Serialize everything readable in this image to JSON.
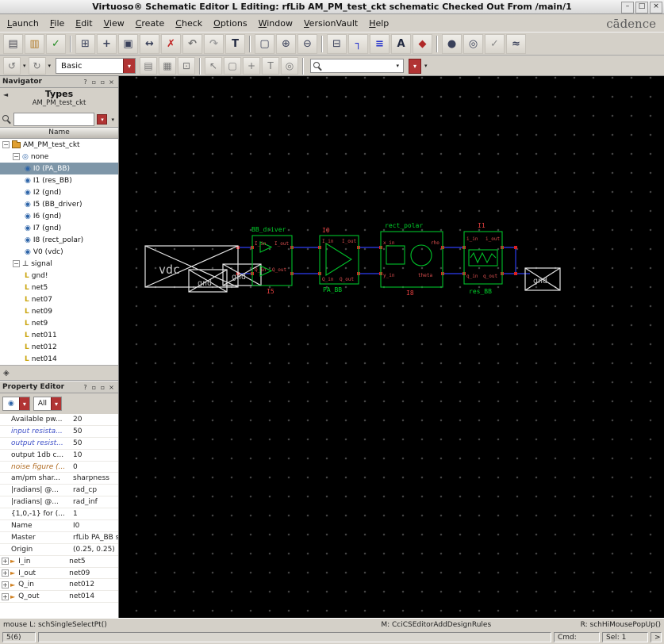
{
  "window": {
    "title": "Virtuoso® Schematic Editor L Editing: rfLib AM_PM_test_ckt schematic Checked Out From /main/1",
    "minimize": "–",
    "maximize": "□",
    "close": "×"
  },
  "menu": {
    "items": [
      "Launch",
      "File",
      "Edit",
      "View",
      "Create",
      "Check",
      "Options",
      "Window",
      "VersionVault",
      "Help"
    ],
    "brand": "cādence"
  },
  "icons": {
    "caret_down": "▾",
    "collapse": "−",
    "expand": "+",
    "help": "?",
    "float": "▫",
    "dock": "▫",
    "close": "×",
    "back": "◄",
    "port": "►",
    "instance": "◉",
    "none_group": "◎",
    "signal_group": "⊥",
    "signal": "L",
    "footer": "◈"
  },
  "toolbar_main": {
    "icons": [
      {
        "name": "new-cellview-icon",
        "glyph": "▤",
        "style": "color:#4a4a55"
      },
      {
        "name": "open-icon",
        "glyph": "▥",
        "style": "color:#b07a28"
      },
      {
        "name": "save-icon",
        "glyph": "✓",
        "style": "color:#1f8a1f;font-weight:bold"
      },
      {
        "name": "descend-icon",
        "glyph": "⊞",
        "style": "color:#39405a"
      },
      {
        "name": "move-icon",
        "glyph": "+",
        "style": "color:#39405a;font-weight:bold"
      },
      {
        "name": "copy-icon",
        "glyph": "▣",
        "style": "color:#39405a"
      },
      {
        "name": "stretch-icon",
        "glyph": "↔",
        "style": "color:#39405a;font-weight:bold"
      },
      {
        "name": "delete-icon",
        "glyph": "✗",
        "style": "color:#c02020;font-weight:bold"
      },
      {
        "name": "undo-icon",
        "glyph": "↶",
        "style": "color:#707070;font-weight:bold"
      },
      {
        "name": "redo-icon",
        "glyph": "↷",
        "style": "color:#9a9a9a;font-weight:bold"
      },
      {
        "name": "property-icon",
        "glyph": "T",
        "style": "color:#202840;font-weight:bold"
      },
      {
        "name": "zoom-fit-icon",
        "glyph": "▢",
        "style": "color:#39405a"
      },
      {
        "name": "zoom-in-icon",
        "glyph": "⊕",
        "style": "color:#39405a"
      },
      {
        "name": "zoom-out-icon",
        "glyph": "⊖",
        "style": "color:#39405a"
      },
      {
        "name": "instance-icon",
        "glyph": "⊟",
        "style": "color:#39405a"
      },
      {
        "name": "wire-icon",
        "glyph": "┐",
        "style": "color:#2633cc;font-weight:bold"
      },
      {
        "name": "wide-wire-icon",
        "glyph": "≡",
        "style": "color:#2633cc;font-weight:bold"
      },
      {
        "name": "wire-label-icon",
        "glyph": "A",
        "style": "color:#202840;font-weight:bold"
      },
      {
        "name": "pin-icon",
        "glyph": "◆",
        "style": "color:#b02828"
      },
      {
        "name": "solder-dot-icon",
        "glyph": "●",
        "style": "color:#39405a"
      },
      {
        "name": "probe-icon",
        "glyph": "◎",
        "style": "color:#39405a"
      },
      {
        "name": "check-icon",
        "glyph": "✓",
        "style": "color:#8a8a8a;font-weight:bold"
      },
      {
        "name": "options-icon",
        "glyph": "≈",
        "style": "color:#39405a;font-weight:bold"
      }
    ]
  },
  "toolbar_second": {
    "history": [
      {
        "name": "previous-view-icon",
        "glyph": "↺"
      },
      {
        "name": "next-view-icon",
        "glyph": "↻"
      }
    ],
    "mode_value": "Basic",
    "icons": [
      {
        "name": "print-icon",
        "glyph": "▤"
      },
      {
        "name": "grid-icon",
        "glyph": "▦"
      },
      {
        "name": "snap-icon",
        "glyph": "⊡"
      }
    ],
    "select_icons": [
      {
        "name": "select-cursor-icon",
        "glyph": "↖"
      },
      {
        "name": "area-select-icon",
        "glyph": "▢"
      },
      {
        "name": "move-cursor-icon",
        "glyph": "+"
      },
      {
        "name": "text-cursor-icon",
        "glyph": "T"
      },
      {
        "name": "probe-cursor-icon",
        "glyph": "◎"
      }
    ],
    "search_value": ""
  },
  "navigator": {
    "title": "Navigator",
    "types_label": "Types",
    "types_value": "AM_PM_test_ckt",
    "search_value": "",
    "name_header": "Name",
    "root": "AM_PM_test_ckt",
    "group": "none",
    "instances": [
      {
        "label": "I0 (PA_BB)",
        "selected": true
      },
      {
        "label": "I1 (res_BB)"
      },
      {
        "label": "I2 (gnd)"
      },
      {
        "label": "I5 (BB_driver)"
      },
      {
        "label": "I6 (gnd)"
      },
      {
        "label": "I7 (gnd)"
      },
      {
        "label": "I8 (rect_polar)"
      },
      {
        "label": "V0 (vdc)"
      }
    ],
    "signal_group": "signal",
    "signals": [
      "gnd!",
      "net5",
      "net07",
      "net09",
      "net9",
      "net011",
      "net012",
      "net014"
    ]
  },
  "property_editor": {
    "title": "Property Editor",
    "filter_all": "All",
    "rows": [
      {
        "name": "Available pw...",
        "value": "20",
        "name_class": "pname"
      },
      {
        "name": "input resista...",
        "value": "50",
        "name_class": "pname em-blue"
      },
      {
        "name": "output resist...",
        "value": "50",
        "name_class": "pname em-blue"
      },
      {
        "name": "output 1db c...",
        "value": "10",
        "name_class": "pname"
      },
      {
        "name": "noise figure (...",
        "value": "0",
        "name_class": "pname em-orange"
      },
      {
        "name": "am/pm shar...",
        "value": "sharpness",
        "name_class": "pname"
      },
      {
        "name": "|radians| @...",
        "value": "rad_cp",
        "name_class": "pname"
      },
      {
        "name": "|radians| @...",
        "value": "rad_inf",
        "name_class": "pname"
      },
      {
        "name": "{1,0,-1} for (...",
        "value": "1",
        "name_class": "pname"
      },
      {
        "name": "Name",
        "value": "I0",
        "name_class": "pname"
      },
      {
        "name": "Master",
        "value": "rfLib PA_BB sy",
        "name_class": "pname"
      },
      {
        "name": "Origin",
        "value": "(0.25, 0.25)",
        "name_class": "pname"
      }
    ],
    "ports": [
      {
        "name": "I_in",
        "value": "net5"
      },
      {
        "name": "I_out",
        "value": "net09"
      },
      {
        "name": "Q_in",
        "value": "net012"
      },
      {
        "name": "Q_out",
        "value": "net014"
      }
    ]
  },
  "schematic": {
    "colors": {
      "block": "#00c22a",
      "wire": "#2633cc",
      "pin": "#dc2020",
      "instance_label": "#e84040",
      "cell_label": "#00d22a",
      "highlight": "#e6e6e6",
      "canvas_bg": "#000000"
    },
    "bb_driver": {
      "name": "BB_driver",
      "inst": "I5",
      "pins": [
        "I_in",
        "I_out",
        "Q_in",
        "Q_out"
      ]
    },
    "pa_bb": {
      "name": "PA_BB",
      "inst": "I0",
      "pins": [
        "I_in",
        "I_out",
        "Q_in",
        "Q_out"
      ]
    },
    "rect_polar": {
      "name": "rect_polar",
      "inst": "I8",
      "pins": [
        "x_in",
        "rho",
        "y_in",
        "theta"
      ]
    },
    "res_bb": {
      "name": "res_BB",
      "inst": "I1",
      "pins": [
        "i_in",
        "i_out",
        "q_in",
        "q_out"
      ]
    },
    "vdc": {
      "label": "vdc"
    },
    "gnd": {
      "label": "gnd"
    }
  },
  "statusbar": {
    "left": "mouse L: schSingleSelectPt()",
    "center": "M: CciCSEditorAddDesignRules",
    "right": "R: schHiMousePopUp()"
  },
  "bottombar": {
    "counter": "5(6)",
    "cmd": "Cmd:",
    "sel": "Sel: 1",
    "expand": ">"
  }
}
